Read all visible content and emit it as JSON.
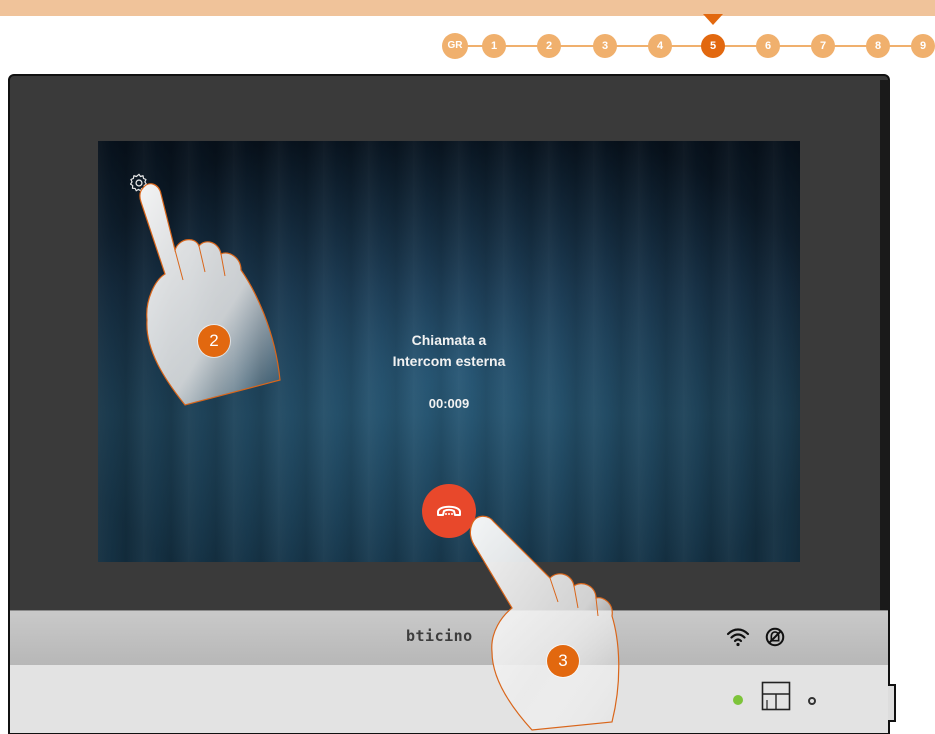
{
  "steps": {
    "items": [
      "GR",
      "1",
      "2",
      "3",
      "4",
      "5",
      "6",
      "7",
      "8",
      "9"
    ],
    "active": "5"
  },
  "screen": {
    "call_line1": "Chiamata a",
    "call_line2": "Intercom esterna",
    "timer": "00:009"
  },
  "device": {
    "brand": "bticino"
  },
  "annotations": {
    "hand_2_label": "2",
    "hand_3_label": "3"
  },
  "icons": {
    "settings": "gear-icon",
    "hangup": "phone-hangup-icon",
    "wifi": "wifi-icon",
    "mute": "bell-off-icon",
    "layout": "window-icon"
  },
  "colors": {
    "accent": "#e2680f",
    "step_inactive": "#f0b06d",
    "hangup": "#e8482b",
    "led": "#7dc43a"
  }
}
